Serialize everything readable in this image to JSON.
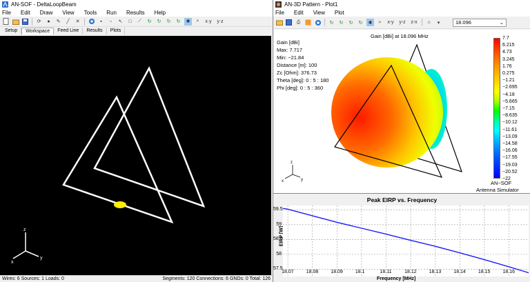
{
  "main": {
    "title": "AN-SOF - DeltaLoopBeam",
    "menu": [
      "File",
      "Edit",
      "Draw",
      "View",
      "Tools",
      "Run",
      "Results",
      "Help"
    ],
    "tabs": [
      "Setup",
      "Workspace",
      "Feed Line",
      "Results",
      "Plots"
    ],
    "active_tab": "Workspace",
    "axes": {
      "x": "x",
      "y": "y",
      "z": "z"
    },
    "status_left": "Wires: 6  Sources: 1  Loads: 0",
    "status_right": "Segments: 120  Connections: 6  GNDs: 0  Total: 126"
  },
  "pattern": {
    "title": "AN-3D Pattern - Plot1",
    "menu": [
      "File",
      "Edit",
      "View",
      "Plot"
    ],
    "toolbar_labels": [
      "x-y",
      "y-z",
      "z-x"
    ],
    "frequency": "18.096",
    "gain_title": "Gain [dBi] at 18.096 MHz",
    "info": [
      "Gain [dBi]",
      "Max: 7.717",
      "Min: −21.84",
      "Distance [m]: 100",
      "Zc [Ohm]: 376.73",
      "Theta [deg]: 0 : 5 : 180",
      "Phi [deg]: 0 : 5 : 360"
    ],
    "colorbar_labels": [
      "7.7",
      "6.215",
      "4.73",
      "3.245",
      "1.76",
      "0.275",
      "−1.21",
      "−2.695",
      "−4.18",
      "−5.665",
      "−7.15",
      "−8.635",
      "−10.12",
      "−11.61",
      "−13.09",
      "−14.58",
      "−16.06",
      "−17.55",
      "−19.03",
      "−20.52",
      "−22"
    ],
    "footer1": "AN−SOF",
    "footer2": "Antenna Simulator",
    "axes": {
      "x": "x",
      "y": "y",
      "z": "z"
    }
  },
  "chart_data": {
    "type": "line",
    "title": "Peak EIRP vs. Frequency",
    "xlabel": "Frequency [MHz]",
    "ylabel": "EIRP [W]",
    "x_ticks": [
      "18.07",
      "18.08",
      "18.09",
      "18.1",
      "18.11",
      "18.12",
      "18.13",
      "18.14",
      "18.15",
      "18.16"
    ],
    "y_ticks": [
      "59.5",
      "59",
      "58.5",
      "58",
      "57.5"
    ],
    "xlim": [
      18.068,
      18.168
    ],
    "ylim": [
      57.3,
      59.6
    ],
    "grid": true,
    "line_color": "#1a1aff",
    "x": [
      18.068,
      18.07,
      18.08,
      18.09,
      18.1,
      18.11,
      18.12,
      18.13,
      18.14,
      18.15,
      18.16,
      18.168
    ],
    "y": [
      59.55,
      59.52,
      59.3,
      59.08,
      58.88,
      58.68,
      58.47,
      58.27,
      58.05,
      57.82,
      57.58,
      57.38
    ]
  }
}
